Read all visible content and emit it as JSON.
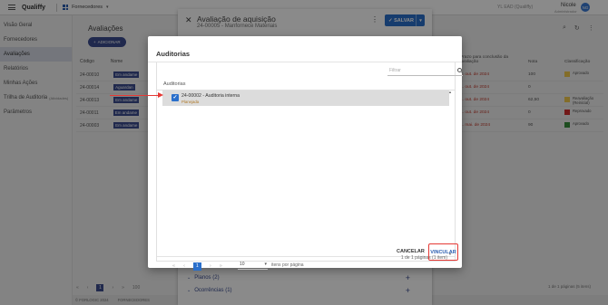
{
  "topbar": {
    "brand": "Qualiffy",
    "module": "Fornecedores",
    "tenant": "YL EAD (Qualiffy)",
    "user_name": "Nicole",
    "user_role": "Administrador",
    "avatar_initials": "NG"
  },
  "sidebar": {
    "items": [
      {
        "label": "Visão Geral"
      },
      {
        "label": "Fornecedores"
      },
      {
        "label": "Avaliações"
      },
      {
        "label": "Relatórios"
      },
      {
        "label": "Minhas Ações"
      },
      {
        "label": "Trilha de Auditoria",
        "sub": "(Atividades)"
      },
      {
        "label": "Parâmetros"
      }
    ]
  },
  "background": {
    "page_title": "Avaliações",
    "add_label": "ADICIONAR",
    "col_code": "Código",
    "col_name": "Nome",
    "rows": [
      {
        "code": "24-00010",
        "pill": "Em andame"
      },
      {
        "code": "24-00014",
        "pill": "Aguardan"
      },
      {
        "code": "24-00013",
        "pill": "Em andame"
      },
      {
        "code": "24-00011",
        "pill": "Em andame"
      },
      {
        "code": "24-00003",
        "pill": "Em andame"
      }
    ],
    "right_header": {
      "deadline": "Prazo para conclusão da avaliação",
      "score": "Nota",
      "classification": "Classificação"
    },
    "right_rows": [
      {
        "date": "... out. de 2024",
        "score": "100",
        "class": "Aprovado",
        "color": "#f2c94c"
      },
      {
        "date": "... out. de 2024",
        "score": "0",
        "class": "",
        "color": ""
      },
      {
        "date": "... out. de 2024",
        "score": "62,50",
        "class": "Reavaliação (Reinicial)",
        "color": "#f2c94c"
      },
      {
        "date": "... out. de 2024",
        "score": "0",
        "class": "Reprovado",
        "color": "#d32f2f"
      },
      {
        "date": "... mai. de 2024",
        "score": "90",
        "class": "Aprovado",
        "color": "#388e3c"
      }
    ],
    "pager_current": "1",
    "per_page": "100",
    "pager_info": "1 de 1 páginas (5 itens)",
    "footer_left": "© FORLOGIC 2024",
    "footer_right": "FORNECEDORES"
  },
  "panel": {
    "title": "Avaliação de aquisição",
    "subtitle": "24-00005 - Manfornece Materiais",
    "save_label": "SALVAR",
    "sections": [
      {
        "label": "Planos",
        "count": "(2)"
      },
      {
        "label": "Ocorrências",
        "count": "(1)"
      }
    ]
  },
  "dialog": {
    "title": "Auditorias",
    "filter_placeholder": "Filtrar",
    "column_header": "Auditorias",
    "rows": [
      {
        "title": "24-00002 - Auditoria interna",
        "status": "Planejada",
        "checked": true
      }
    ],
    "pager_current": "1",
    "per_page": "10",
    "per_page_label": "itens por página",
    "page_info": "1 de 1 páginas (1 item)",
    "cancel_label": "CANCELAR",
    "link_label": "VINCULAR"
  },
  "colors": {
    "primary": "#2a6fcb",
    "navy": "#3b4d8f",
    "annotation": "#e53935"
  }
}
